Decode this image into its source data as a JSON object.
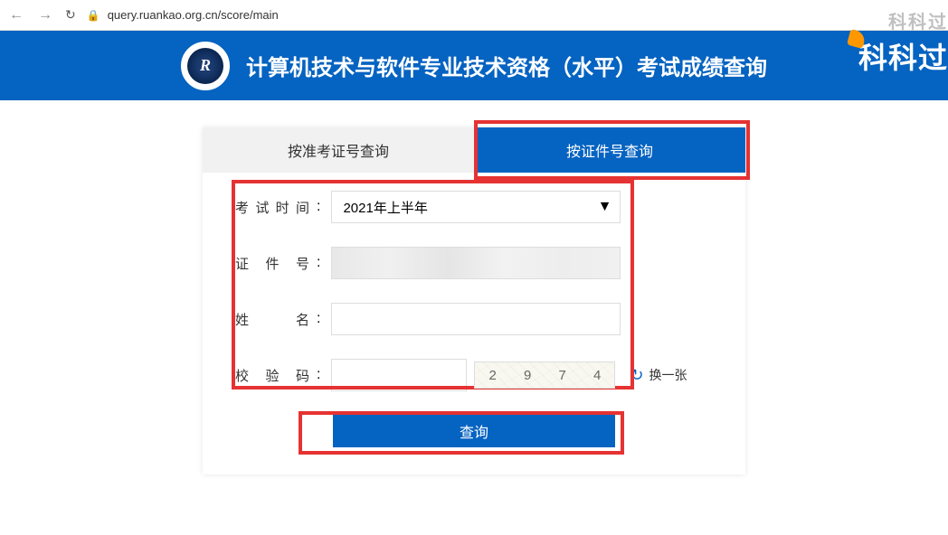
{
  "browser": {
    "url": "query.ruankao.org.cn/score/main"
  },
  "header": {
    "title": "计算机技术与软件专业技术资格（水平）考试成绩查询",
    "logo_letter": "R"
  },
  "watermark": {
    "top": "科科过",
    "main": "科科过"
  },
  "tabs": {
    "tab1": "按准考证号查询",
    "tab2": "按证件号查询"
  },
  "form": {
    "exam_time_label": "考试时间",
    "id_label": "证 件 号",
    "name_label": "姓　　名",
    "captcha_label": "校 验 码",
    "exam_time_value": "2021年上半年",
    "id_value": "",
    "name_value": "",
    "captcha_value": "",
    "captcha_digits": [
      "2",
      "9",
      "7",
      "4"
    ],
    "refresh_label": "换一张",
    "submit_label": "查询"
  }
}
